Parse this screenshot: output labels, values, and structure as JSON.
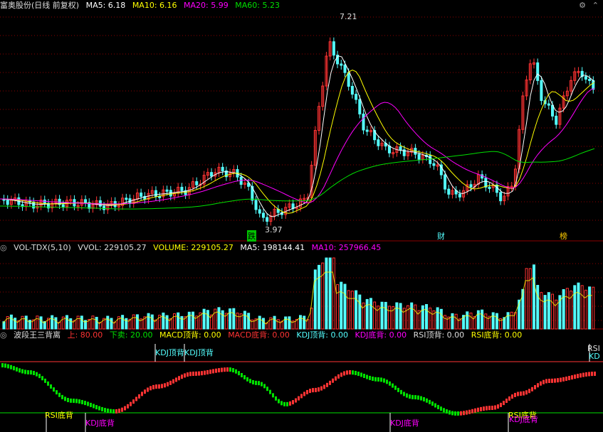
{
  "main_panel": {
    "title": "富奥股份(日线 前复权)",
    "ma5": "MA5: 6.18",
    "ma10": "MA10: 6.16",
    "ma20": "MA20: 5.99",
    "ma60": "MA60: 5.23",
    "high_label": "7.21",
    "low_label": "3.97",
    "markers": {
      "die": "跌",
      "cai": "财",
      "bang": "榜"
    }
  },
  "volume_panel": {
    "name": "VOL-TDX(5,10)",
    "vvol": "VVOL: 229105.27",
    "volume": "VOLUME: 229105.27",
    "ma5": "MA5: 198144.41",
    "ma10": "MA10: 257966.45"
  },
  "indicator_panel": {
    "name": "波段王三背离",
    "up": "上: 80.00",
    "down": "下卖: 20.00",
    "macd_top": "MACD顶背: 0.00",
    "macd_bottom": "MACD底背: 0.00",
    "kdj_top": "KDJ顶背: 0.00",
    "kdj_bottom": "KDJ底背: 0.00",
    "rsi_top": "RSI顶背: 0.00",
    "rsi_bottom": "RSI底背: 0.00",
    "tags": {
      "kdj_top_1": "KDJ顶背",
      "kdj_top_2": "KDJ顶背",
      "rsi_bottom_1": "RSI底背",
      "kdj_bottom_1": "KDJ底背",
      "kdj_bottom_2": "KDJ底背",
      "rsi_bottom_2": "RSI底背",
      "kdj_bottom_3": "KDJ底背",
      "rsi_right": "RSI",
      "kd_right": "KD"
    }
  },
  "colors": {
    "up": "#ff3333",
    "down": "#54ffff",
    "ma5": "#ffffff",
    "ma10": "#ffff00",
    "ma20": "#ff00ff",
    "ma60": "#00e000",
    "grid": "#8b0000"
  },
  "icons": {
    "settings": "gear-icon",
    "collapse": "chevron-up-icon"
  }
}
